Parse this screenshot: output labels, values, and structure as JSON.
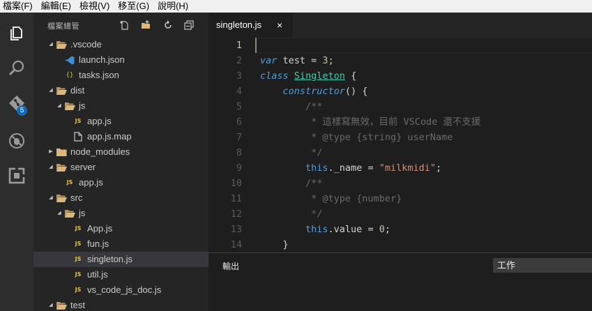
{
  "menubar": {
    "items": [
      "檔案(F)",
      "編輯(E)",
      "檢視(V)",
      "移至(G)",
      "說明(H)"
    ]
  },
  "activitybar": {
    "items": [
      {
        "name": "explorer-icon",
        "active": true
      },
      {
        "name": "search-icon",
        "active": false
      },
      {
        "name": "git-icon",
        "active": false,
        "badge": "5"
      },
      {
        "name": "debug-icon",
        "active": false
      },
      {
        "name": "extensions-icon",
        "active": false
      }
    ]
  },
  "sidebar": {
    "title": "檔案總管",
    "actions": [
      "new-file-icon",
      "new-folder-icon",
      "refresh-icon",
      "collapse-all-icon"
    ],
    "tree": [
      {
        "label": ".vscode",
        "type": "folder",
        "level": 0,
        "expanded": true
      },
      {
        "label": "launch.json",
        "type": "vscode",
        "level": 1
      },
      {
        "label": "tasks.json",
        "type": "json",
        "level": 1
      },
      {
        "label": "dist",
        "type": "folder",
        "level": 0,
        "expanded": true
      },
      {
        "label": "js",
        "type": "folder",
        "level": 1,
        "expanded": true
      },
      {
        "label": "app.js",
        "type": "js",
        "level": 2
      },
      {
        "label": "app.js.map",
        "type": "file",
        "level": 2
      },
      {
        "label": "node_modules",
        "type": "folder",
        "level": 0,
        "expanded": false
      },
      {
        "label": "server",
        "type": "folder",
        "level": 0,
        "expanded": true
      },
      {
        "label": "app.js",
        "type": "js",
        "level": 1
      },
      {
        "label": "src",
        "type": "folder",
        "level": 0,
        "expanded": true
      },
      {
        "label": "js",
        "type": "folder",
        "level": 1,
        "expanded": true
      },
      {
        "label": "App.js",
        "type": "js",
        "level": 2
      },
      {
        "label": "fun.js",
        "type": "js",
        "level": 2
      },
      {
        "label": "singleton.js",
        "type": "js",
        "level": 2,
        "selected": true
      },
      {
        "label": "util.js",
        "type": "js",
        "level": 2
      },
      {
        "label": "vs_code_js_doc.js",
        "type": "js",
        "level": 2
      },
      {
        "label": "test",
        "type": "folder",
        "level": 0,
        "expanded": true
      }
    ]
  },
  "tabs": [
    {
      "label": "singleton.js",
      "close": "×",
      "active": true
    }
  ],
  "editor": {
    "active_line": 1,
    "lines": [
      {
        "n": "1",
        "tokens": []
      },
      {
        "n": "2",
        "tokens": [
          [
            "kw",
            "var"
          ],
          [
            "plain",
            " test = "
          ],
          [
            "num",
            "3"
          ],
          [
            "plain",
            ";"
          ]
        ]
      },
      {
        "n": "3",
        "tokens": [
          [
            "kw",
            "class"
          ],
          [
            "plain",
            " "
          ],
          [
            "cls",
            "Singleton"
          ],
          [
            "plain",
            " {"
          ]
        ]
      },
      {
        "n": "4",
        "tokens": [
          [
            "plain",
            "    "
          ],
          [
            "fn",
            "constructor"
          ],
          [
            "plain",
            "() {"
          ]
        ]
      },
      {
        "n": "5",
        "tokens": [
          [
            "plain",
            "        "
          ],
          [
            "cm2",
            "/**"
          ]
        ]
      },
      {
        "n": "6",
        "tokens": [
          [
            "plain",
            "         "
          ],
          [
            "cm2",
            "* 這樣寫無效，目前 VSCode 還不支援"
          ]
        ]
      },
      {
        "n": "7",
        "tokens": [
          [
            "plain",
            "         "
          ],
          [
            "cm2",
            "* @type {string} userName"
          ]
        ]
      },
      {
        "n": "8",
        "tokens": [
          [
            "plain",
            "         "
          ],
          [
            "cm2",
            "*/"
          ]
        ]
      },
      {
        "n": "9",
        "tokens": [
          [
            "plain",
            "        "
          ],
          [
            "this",
            "this"
          ],
          [
            "plain",
            "._name = "
          ],
          [
            "str",
            "\"milkmidi\""
          ],
          [
            "plain",
            ";"
          ]
        ]
      },
      {
        "n": "10",
        "tokens": [
          [
            "plain",
            "        "
          ],
          [
            "cm2",
            "/**"
          ]
        ]
      },
      {
        "n": "11",
        "tokens": [
          [
            "plain",
            "         "
          ],
          [
            "cm2",
            "* @type {number}"
          ]
        ]
      },
      {
        "n": "12",
        "tokens": [
          [
            "plain",
            "         "
          ],
          [
            "cm2",
            "*/"
          ]
        ]
      },
      {
        "n": "13",
        "tokens": [
          [
            "plain",
            "        "
          ],
          [
            "this",
            "this"
          ],
          [
            "plain",
            ".value = "
          ],
          [
            "num",
            "0"
          ],
          [
            "plain",
            ";"
          ]
        ]
      },
      {
        "n": "14",
        "tokens": [
          [
            "plain",
            "    }"
          ]
        ]
      }
    ]
  },
  "panel": {
    "title": "輸出",
    "select_value": "工作"
  },
  "colors": {
    "accent": "#0f6bbd",
    "js_icon": "#e8c341",
    "folder_icon": "#dcb67a"
  }
}
